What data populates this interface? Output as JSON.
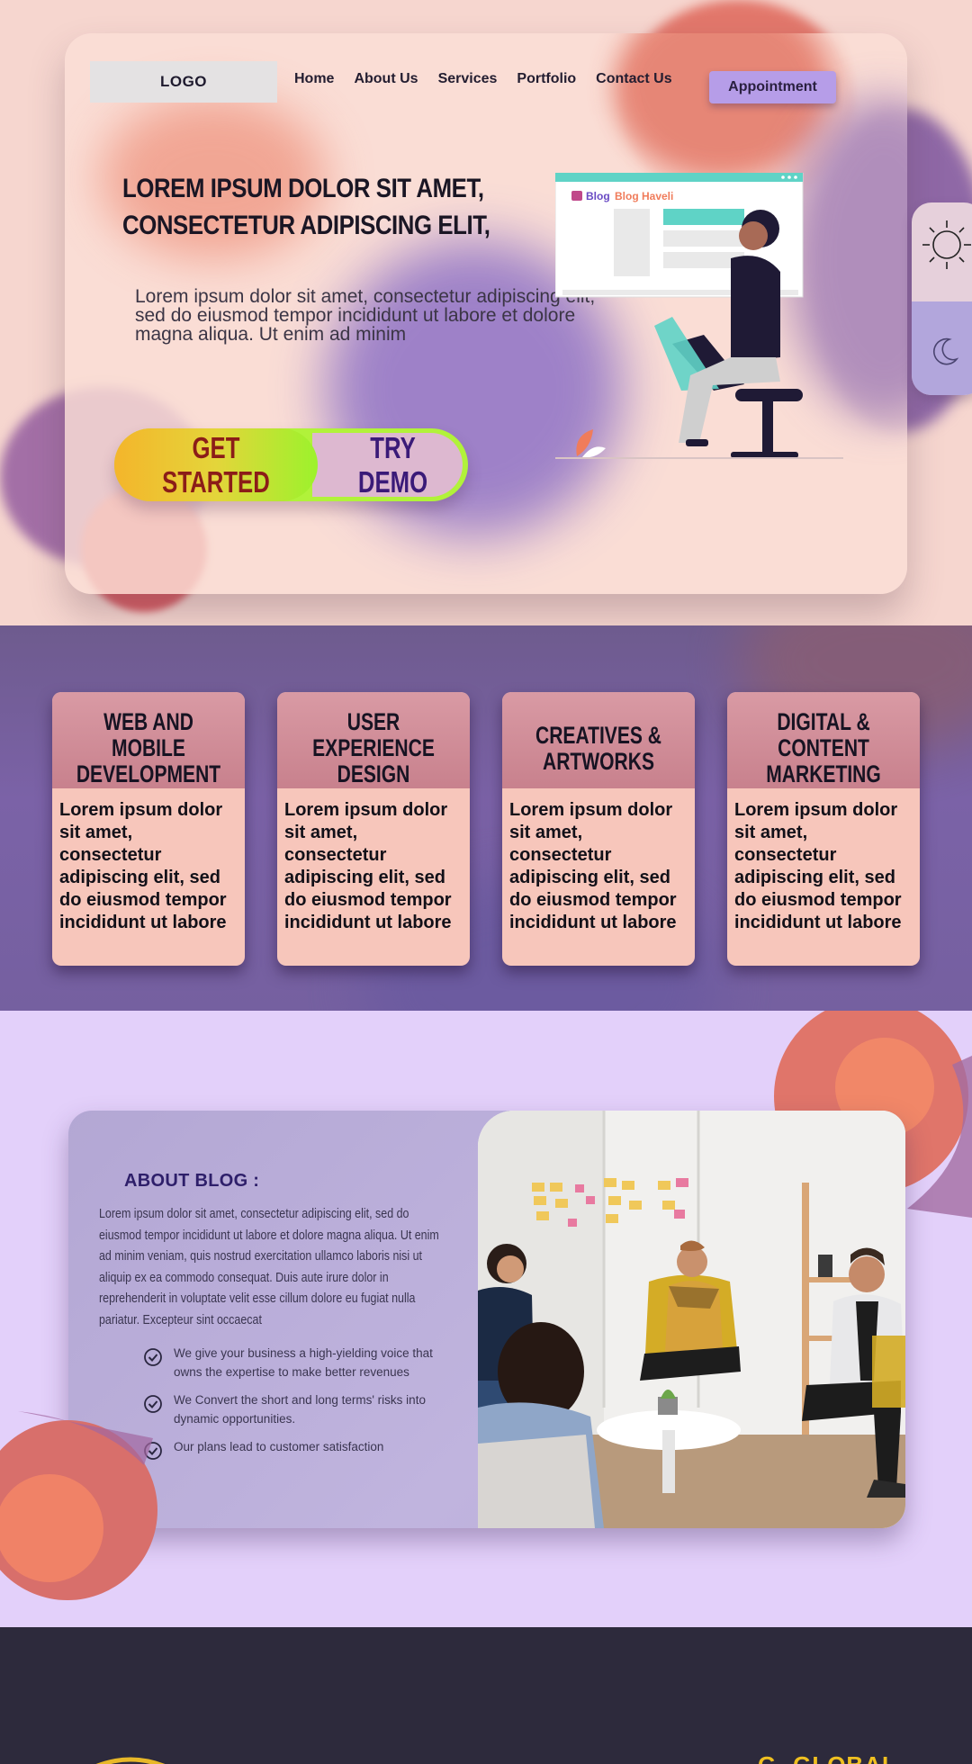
{
  "header": {
    "logo_text": "LOGO",
    "nav": [
      "Home",
      "About Us",
      "Services",
      "Portfolio",
      "Contact Us"
    ],
    "appointment_label": "Appointment"
  },
  "hero": {
    "title_line1": "LOREM IPSUM DOLOR SIT AMET,",
    "title_line2": "CONSECTETUR ADIPISCING ELIT,",
    "description": "Lorem ipsum dolor sit amet, consectetur adipiscing elit, sed do eiusmod tempor incididunt ut labore et dolore magna aliqua. Ut enim ad minim",
    "get_started_label": "GET STARTED",
    "try_demo_label": "TRY DEMO",
    "illustration_brand": "Blog Haveli"
  },
  "theme_toggle": {
    "light_icon": "sun-icon",
    "dark_icon": "moon-icon"
  },
  "services": [
    {
      "title": "WEB AND MOBILE DEVELOPMENT",
      "body": "Lorem ipsum dolor sit amet, consectetur adipiscing elit, sed do eiusmod tempor incididunt ut labore"
    },
    {
      "title": "USER EXPERIENCE DESIGN",
      "body": "Lorem ipsum dolor sit amet, consectetur adipiscing elit, sed do eiusmod tempor incididunt ut labore"
    },
    {
      "title": "CREATIVES & ARTWORKS",
      "body": "Lorem ipsum dolor sit amet, consectetur adipiscing elit, sed do eiusmod tempor incididunt ut labore"
    },
    {
      "title": "DIGITAL & CONTENT MARKETING",
      "body": "Lorem ipsum dolor sit amet, consectetur adipiscing elit, sed do eiusmod tempor incididunt ut labore"
    }
  ],
  "about": {
    "title": "ABOUT BLOG  :",
    "text": "Lorem ipsum dolor sit amet, consectetur adipiscing elit, sed do eiusmod tempor incididunt ut labore et dolore magna aliqua. Ut enim ad minim veniam, quis nostrud exercitation ullamco laboris nisi ut aliquip ex ea commodo consequat. Duis aute irure dolor in reprehenderit in voluptate velit esse cillum dolore eu fugiat nulla pariatur. Excepteur sint occaecat",
    "points": [
      "We give your business a high-yielding voice that owns the expertise to make better revenues",
      "We Convert the short and long terms' risks into dynamic opportunities.",
      "Our plans lead to customer satisfaction"
    ]
  },
  "footer": {
    "brand": "G- GLOBAL"
  },
  "colors": {
    "hero_bg": "#f6d6cf",
    "accent_purple": "#b69de8",
    "services_bg": "#7b62a7",
    "card_pink": "#f7c6bb",
    "about_bg": "#e3d0fa",
    "footer_bg": "#2d2a3c",
    "footer_brand": "#f0c020"
  }
}
